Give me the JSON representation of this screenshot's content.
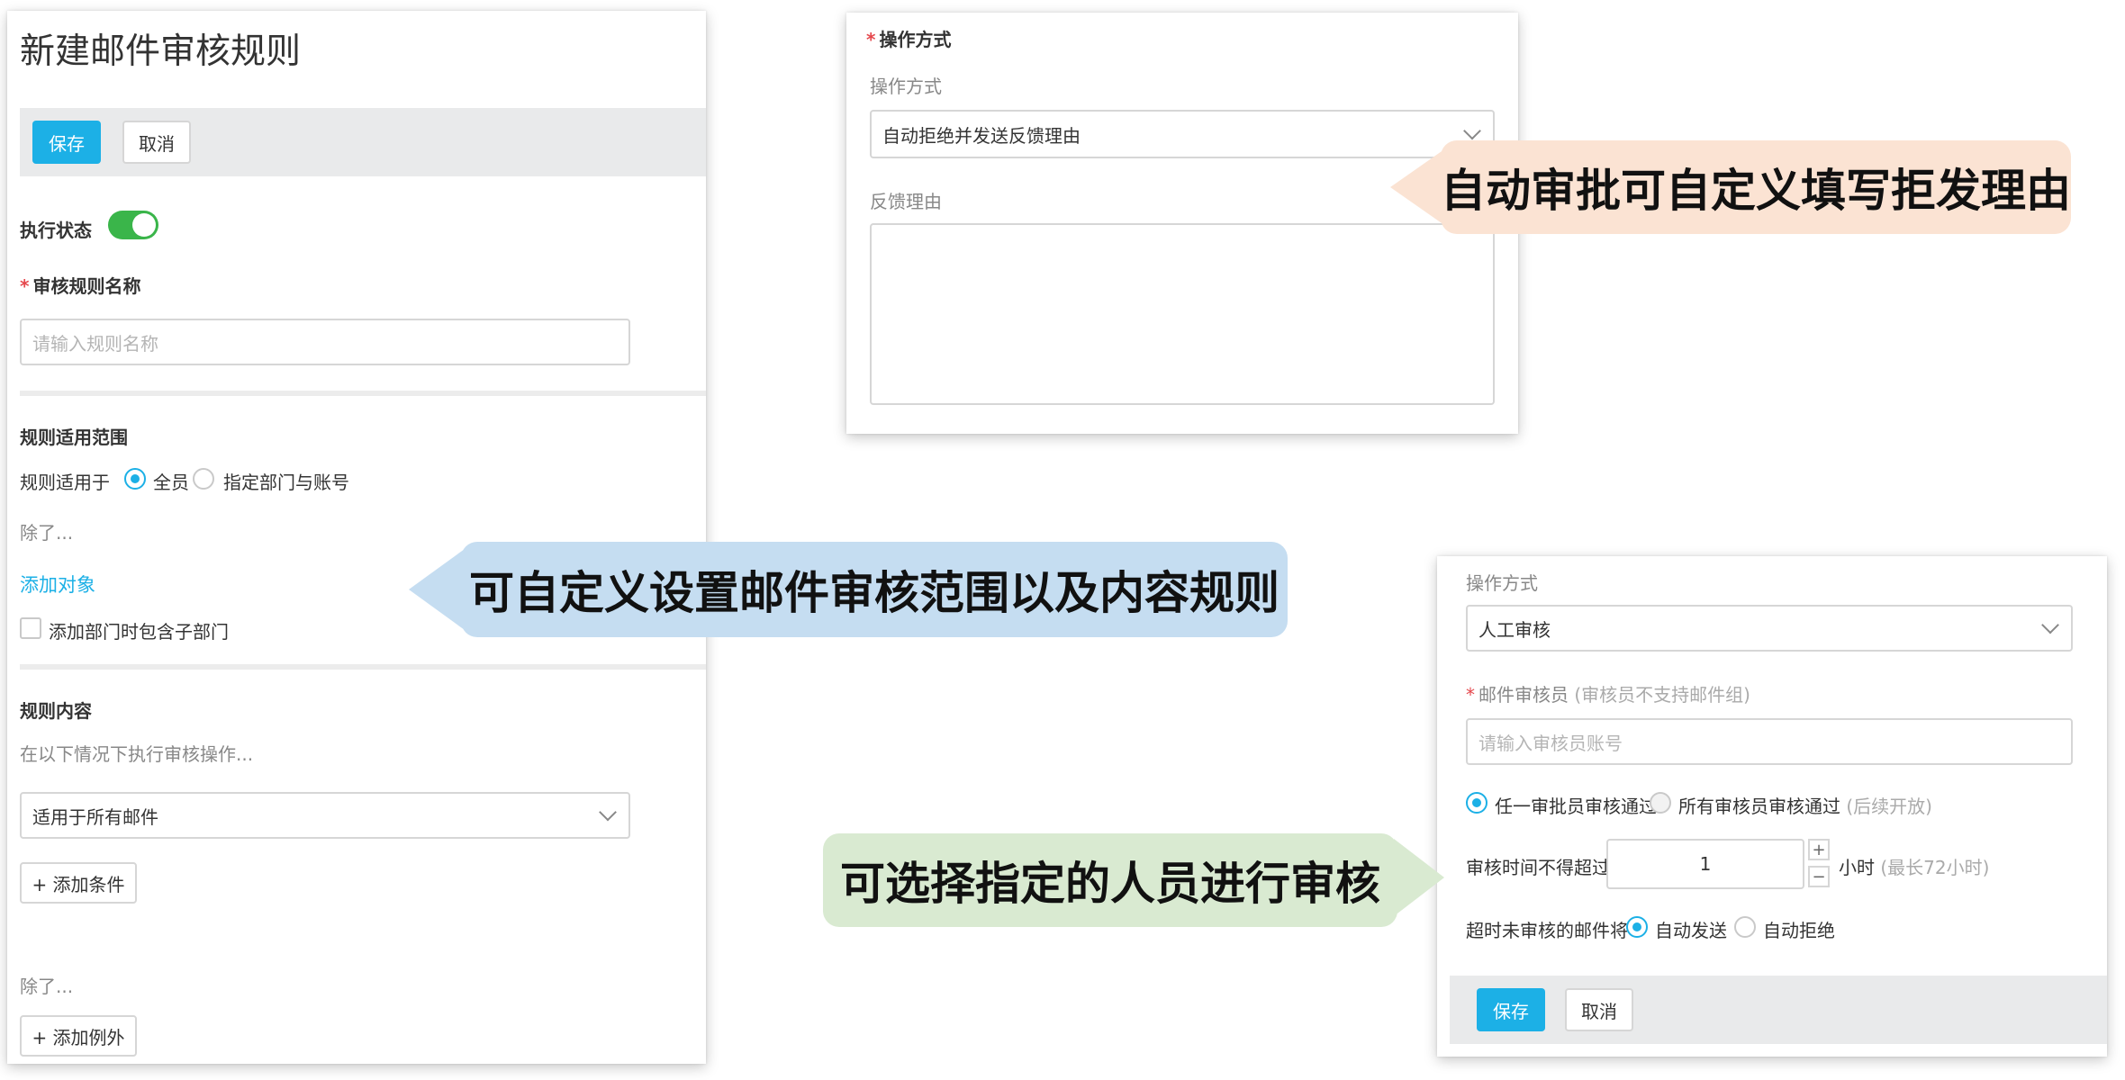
{
  "left_panel": {
    "title": "新建邮件审核规则",
    "save_label": "保存",
    "cancel_label": "取消",
    "status_label": "执行状态",
    "rule_name_label": "审核规则名称",
    "rule_name_placeholder": "请输入规则名称",
    "scope_section_title": "规则适用范围",
    "scope_applies_label": "规则适用于",
    "scope_option_all": "全员",
    "scope_option_specific": "指定部门与账号",
    "except_label_1": "除了...",
    "add_object_link": "添加对象",
    "include_sub_label": "添加部门时包含子部门",
    "content_section_title": "规则内容",
    "content_hint": "在以下情况下执行审核操作...",
    "content_select_value": "适用于所有邮件",
    "add_condition_label": "+ 添加条件",
    "except_label_2": "除了...",
    "add_exception_label": "+ 添加例外"
  },
  "top_panel": {
    "section_title": "操作方式",
    "operation_label": "操作方式",
    "operation_value": "自动拒绝并发送反馈理由",
    "feedback_label": "反馈理由"
  },
  "bottom_panel": {
    "operation_label": "操作方式",
    "operation_value": "人工审核",
    "reviewer_label": "邮件审核员",
    "reviewer_note": "(审核员不支持邮件组)",
    "reviewer_placeholder": "请输入审核员账号",
    "approval_option_any": "任一审批员审核通过",
    "approval_option_all": "所有审核员审核通过",
    "approval_option_all_note": "(后续开放)",
    "time_limit_label": "审核时间不得超过",
    "time_limit_value": "1",
    "time_unit": "小时",
    "time_unit_note": "(最长72小时)",
    "timeout_label": "超时未审核的邮件将",
    "timeout_option_send": "自动发送",
    "timeout_option_reject": "自动拒绝",
    "save_label": "保存",
    "cancel_label": "取消"
  },
  "callouts": {
    "top": "自动审批可自定义填写拒发理由",
    "middle": "可自定义设置邮件审核范围以及内容规则",
    "bottom": "可选择指定的人员进行审核"
  },
  "colors": {
    "primary": "#1cb0e6",
    "toggle_on": "#3ab54a",
    "callout_top_bg": "#fbe3d3",
    "callout_middle_bg": "#c5ddf1",
    "callout_bottom_bg": "#d9ead1"
  }
}
